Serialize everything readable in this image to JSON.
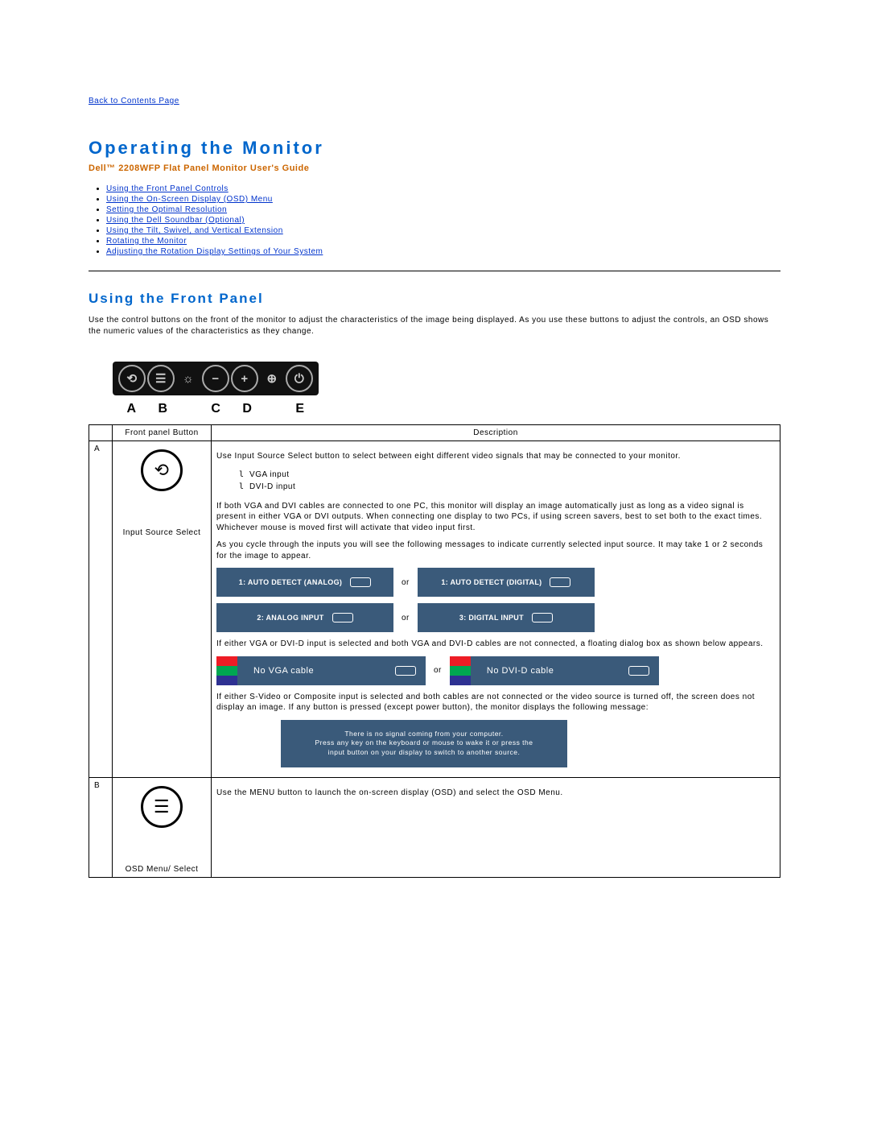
{
  "back_link": "Back to Contents Page",
  "title": "Operating the Monitor",
  "subtitle": "Dell™ 2208WFP Flat Panel Monitor User's Guide",
  "toc": [
    "Using the Front Panel Controls",
    "Using the On-Screen Display (OSD) Menu",
    "Setting the Optimal Resolution",
    "Using the Dell Soundbar (Optional)",
    "Using the Tilt, Swivel, and Vertical Extension",
    "Rotating  the Monitor",
    "Adjusting the Rotation Display Settings of Your System"
  ],
  "section_heading": "Using the Front Panel",
  "intro_para": "Use the control buttons on the front of the monitor to adjust the characteristics of the image being displayed. As you use these buttons to adjust the controls, an OSD shows the numeric values of the characteristics as they change.",
  "panel_labels": [
    "A",
    "B",
    "C",
    "D",
    "E"
  ],
  "table": {
    "head_btn": "Front panel Button",
    "head_desc": "Description",
    "rowA": {
      "letter": "A",
      "caption": "Input Source Select",
      "d1": "Use Input Source Select button to select between eight different video signals that may be connected to your monitor.",
      "inputs": [
        "VGA input",
        "DVI-D input"
      ],
      "d2": "If both VGA and DVI cables are connected to one PC, this monitor will display an image automatically just as long as a video signal is present in either VGA or DVI outputs. When connecting one display to two PCs, if using screen savers, best to set both to the exact times. Whichever mouse is moved first will activate that video input first.",
      "d3": "As you cycle through the inputs you will see the following messages to indicate currently selected input source. It may take 1 or 2 seconds for the image to appear.",
      "bar_auto_analog": "1: AUTO DETECT (ANALOG)",
      "bar_auto_digital": "1: AUTO DETECT (DIGITAL)",
      "bar_analog": "2: ANALOG INPUT",
      "bar_digital": "3: DIGITAL INPUT",
      "or": "or",
      "d4": "If either VGA or DVI-D input is selected and both VGA and DVI-D cables are not connected, a floating dialog box as shown below appears.",
      "no_vga": "No VGA cable",
      "no_dvid": "No DVI-D cable",
      "d5": "If either S-Video or Composite input is selected and both cables are not connected or the video source is turned off, the screen does not display an image. If any button is pressed (except power button), the monitor displays the following message:",
      "msg_l1": "There is no signal coming from your computer.",
      "msg_l2": "Press any key on the keyboard or mouse to wake it or  press the",
      "msg_l3": "input button on your display to switch to another source."
    },
    "rowB": {
      "letter": "B",
      "caption": "OSD Menu/ Select",
      "d1": "Use the MENU button to launch the on-screen display (OSD) and select the OSD Menu."
    }
  }
}
